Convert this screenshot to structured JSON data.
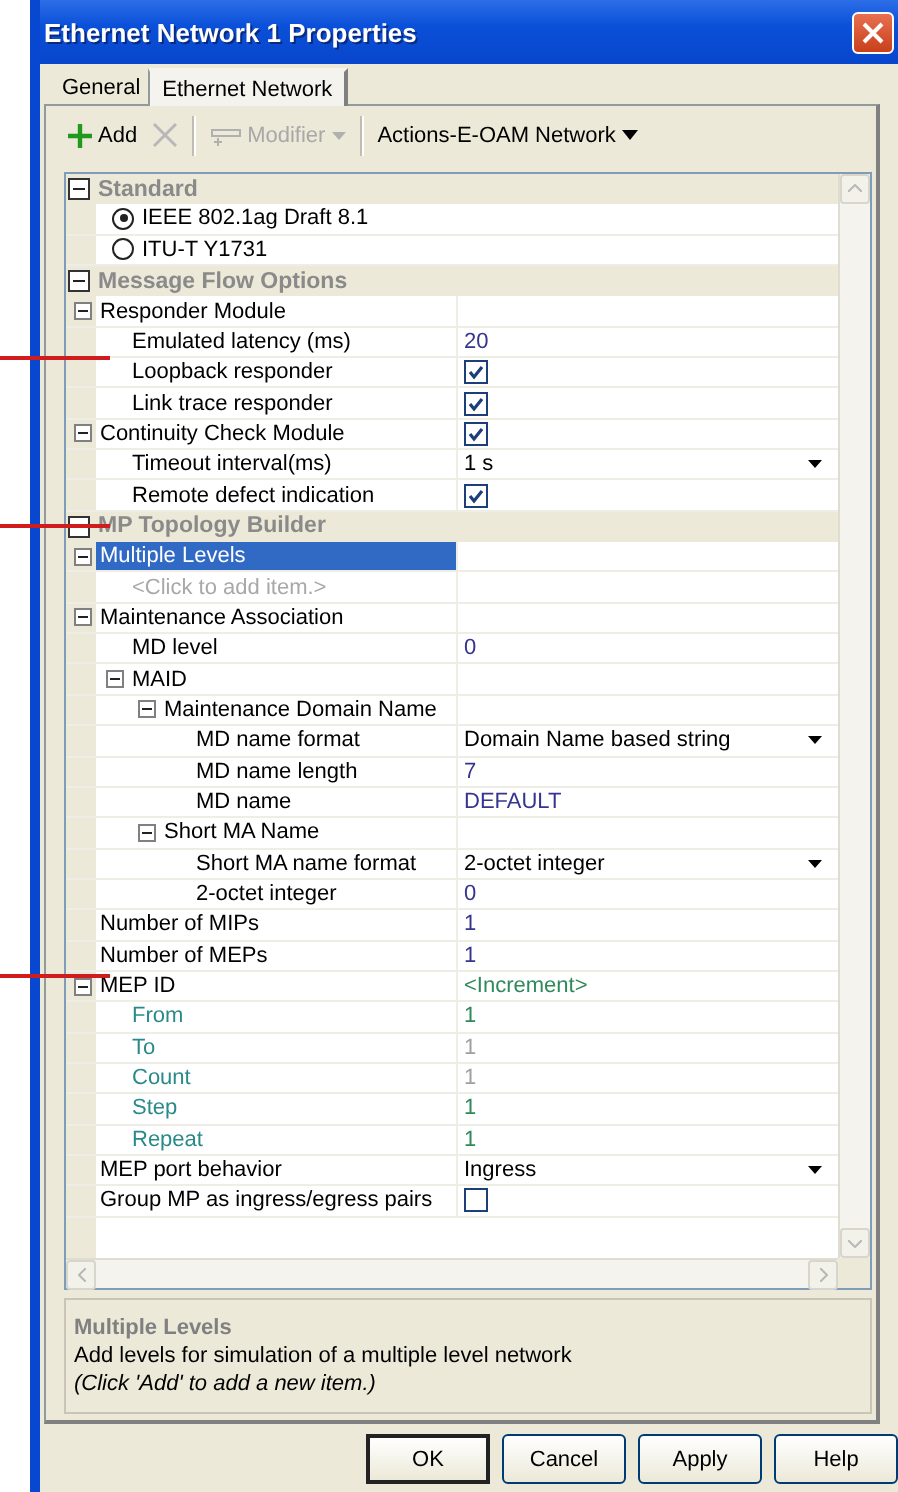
{
  "window": {
    "title": "Ethernet Network 1 Properties"
  },
  "tabs": [
    {
      "label": "General",
      "selected": false
    },
    {
      "label": "Ethernet Network",
      "selected": true
    }
  ],
  "toolbar": [
    {
      "kind": "add",
      "label": "Add",
      "disabled": false
    },
    {
      "kind": "delete",
      "disabled": true
    },
    {
      "kind": "modifier",
      "label": "Modifier",
      "disabled": true
    },
    {
      "kind": "menu",
      "label": "Actions-E-OAM Network",
      "disabled": false
    }
  ],
  "grid": {
    "sections": [
      {
        "title": "Standard",
        "expanded": true,
        "items": [
          {
            "kind": "radio",
            "label": "IEEE 802.1ag Draft 8.1",
            "selected": true
          },
          {
            "kind": "radio",
            "label": "ITU-T Y1731",
            "selected": false
          }
        ]
      },
      {
        "title": "Message Flow Options",
        "expanded": true,
        "items": [
          {
            "kind": "property",
            "label": "Responder Module",
            "selected": false,
            "expanded": true,
            "children": [
              {
                "kind": "property",
                "label": "Emulated latency (ms)",
                "selected": false,
                "value": {
                  "kind": "text",
                  "text": "20",
                  "modified": true
                }
              },
              {
                "kind": "property",
                "label": "Loopback responder",
                "selected": false,
                "value": {
                  "kind": "check",
                  "checked": true
                }
              },
              {
                "kind": "property",
                "label": "Link trace responder",
                "selected": false,
                "value": {
                  "kind": "check",
                  "checked": true
                }
              }
            ]
          },
          {
            "kind": "property",
            "label": "Continuity Check Module",
            "selected": false,
            "expanded": true,
            "value": {
              "kind": "check",
              "checked": true
            },
            "children": [
              {
                "kind": "property",
                "label": "Timeout interval(ms)",
                "selected": false,
                "value": {
                  "kind": "dropdown",
                  "text": "1 s",
                  "modified": false
                }
              },
              {
                "kind": "property",
                "label": "Remote defect indication",
                "selected": false,
                "value": {
                  "kind": "check",
                  "checked": true
                }
              }
            ]
          }
        ]
      },
      {
        "title": "MP Topology Builder",
        "expanded": true,
        "items": [
          {
            "kind": "property",
            "label": "Multiple Levels",
            "selected": true,
            "expanded": true,
            "children": [
              {
                "kind": "add_item",
                "label": "<Click to add item.>"
              }
            ]
          },
          {
            "kind": "property",
            "label": "Maintenance Association",
            "selected": false,
            "expanded": true,
            "children": [
              {
                "kind": "property",
                "label": "MD level",
                "selected": false,
                "value": {
                  "kind": "text",
                  "text": "0",
                  "modified": true
                }
              },
              {
                "kind": "property",
                "label": "MAID",
                "selected": false,
                "expanded": true,
                "children": [
                  {
                    "kind": "property",
                    "label": "Maintenance Domain Name",
                    "selected": false,
                    "expanded": true,
                    "children": [
                      {
                        "kind": "property",
                        "label": "MD name format",
                        "selected": false,
                        "value": {
                          "kind": "dropdown",
                          "text": "Domain Name based string",
                          "modified": false
                        }
                      },
                      {
                        "kind": "property",
                        "label": "MD name length",
                        "selected": false,
                        "value": {
                          "kind": "text",
                          "text": "7",
                          "modified": true
                        }
                      },
                      {
                        "kind": "property",
                        "label": "MD name",
                        "selected": false,
                        "value": {
                          "kind": "text",
                          "text": "DEFAULT",
                          "modified": true
                        }
                      }
                    ]
                  },
                  {
                    "kind": "property",
                    "label": "Short MA Name",
                    "selected": false,
                    "expanded": true,
                    "children": [
                      {
                        "kind": "property",
                        "label": "Short MA name format",
                        "selected": false,
                        "value": {
                          "kind": "dropdown",
                          "text": "2-octet integer",
                          "modified": false
                        }
                      },
                      {
                        "kind": "property",
                        "label": "2-octet integer",
                        "selected": false,
                        "value": {
                          "kind": "text",
                          "text": "0",
                          "modified": true
                        }
                      }
                    ]
                  }
                ]
              }
            ]
          },
          {
            "kind": "property",
            "label": "Number of MIPs",
            "selected": false,
            "value": {
              "kind": "text",
              "text": "1",
              "modified": true
            }
          },
          {
            "kind": "property",
            "label": "Number of MEPs",
            "selected": false,
            "value": {
              "kind": "text",
              "text": "1",
              "modified": true
            }
          },
          {
            "kind": "property",
            "label": "MEP ID",
            "selected": false,
            "expanded": true,
            "value": {
              "kind": "text",
              "text": "<Increment>",
              "generated": true
            },
            "children": [
              {
                "kind": "property",
                "label": "From",
                "selected": false,
                "generated": true,
                "value": {
                  "kind": "text",
                  "text": "1",
                  "generated": true,
                  "disabled": false
                }
              },
              {
                "kind": "property",
                "label": "To",
                "selected": false,
                "generated": true,
                "value": {
                  "kind": "text",
                  "text": "1",
                  "generated": true,
                  "disabled": true
                }
              },
              {
                "kind": "property",
                "label": "Count",
                "selected": false,
                "generated": true,
                "value": {
                  "kind": "text",
                  "text": "1",
                  "generated": true,
                  "disabled": true
                }
              },
              {
                "kind": "property",
                "label": "Step",
                "selected": false,
                "generated": true,
                "value": {
                  "kind": "text",
                  "text": "1",
                  "generated": true,
                  "disabled": false
                }
              },
              {
                "kind": "property",
                "label": "Repeat",
                "selected": false,
                "generated": true,
                "value": {
                  "kind": "text",
                  "text": "1",
                  "generated": true,
                  "disabled": false
                }
              }
            ]
          },
          {
            "kind": "property",
            "label": "MEP port behavior",
            "selected": false,
            "value": {
              "kind": "dropdown",
              "text": "Ingress",
              "modified": false
            }
          },
          {
            "kind": "property",
            "label": "Group MP as ingress/egress pairs",
            "selected": false,
            "value": {
              "kind": "check",
              "checked": false
            }
          }
        ]
      }
    ]
  },
  "description": {
    "title": "Multiple Levels",
    "text": "Add levels for simulation of a multiple level network",
    "hint": "(Click 'Add' to add a new item.)"
  },
  "buttons": [
    {
      "label": "OK",
      "default": true
    },
    {
      "label": "Cancel",
      "default": false
    },
    {
      "label": "Apply",
      "default": false
    },
    {
      "label": "Help",
      "default": false
    }
  ]
}
